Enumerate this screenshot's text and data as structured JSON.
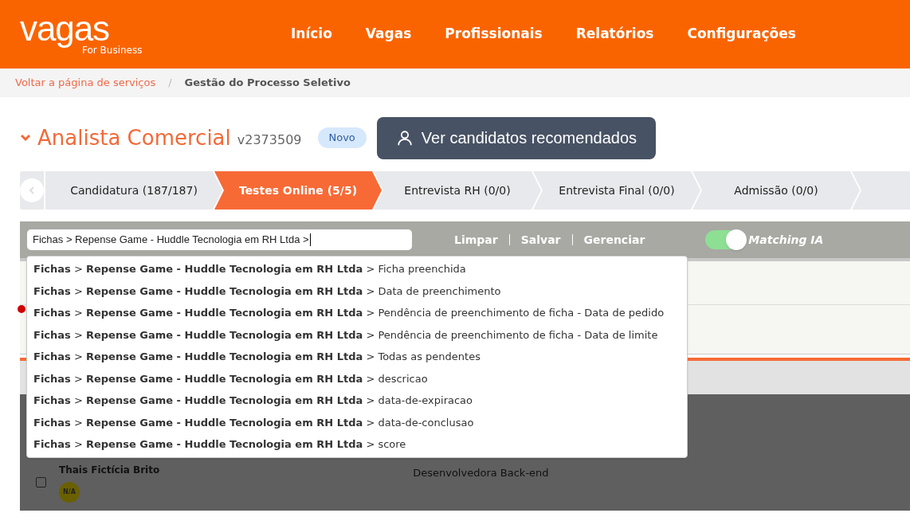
{
  "header": {
    "logo": "vagas",
    "logo_sub": "For Business",
    "nav": [
      {
        "label": "Início"
      },
      {
        "label": "Vagas"
      },
      {
        "label": "Profissionais"
      },
      {
        "label": "Relatórios"
      },
      {
        "label": "Configurações"
      }
    ]
  },
  "breadcrumb": {
    "link": "Voltar a página de serviços",
    "separator": "/",
    "current": "Gestão do Processo Seletivo"
  },
  "job": {
    "expanded": true,
    "title": "Analista Comercial",
    "code": "v2373509",
    "badge": "Novo",
    "recommend_button": "Ver candidatos recomendados"
  },
  "stages": [
    {
      "label": "Candidatura (187/187)",
      "selected": false
    },
    {
      "label": "Testes Online (5/5)",
      "selected": true
    },
    {
      "label": "Entrevista RH (0/0)",
      "selected": false
    },
    {
      "label": "Entrevista Final (0/0)",
      "selected": false
    },
    {
      "label": "Admissão (0/0)",
      "selected": false
    }
  ],
  "filter": {
    "value": "Fichas > Repense Game - Huddle Tecnologia em RH Ltda >",
    "actions": [
      "Limpar",
      "Salvar",
      "Gerenciar"
    ],
    "matching": {
      "label": "Matching IA",
      "on": true
    }
  },
  "suggestions": [
    "**Fichas** > **Repense Game - Huddle Tecnologia em RH Ltda** > Ficha preenchida",
    "**Fichas** > **Repense Game - Huddle Tecnologia em RH Ltda** > Data de preenchimento",
    "**Fichas** > **Repense Game - Huddle Tecnologia em RH Ltda** > Pendência de preenchimento de ficha - Data de pedido",
    "**Fichas** > **Repense Game - Huddle Tecnologia em RH Ltda** > Pendência de preenchimento de ficha - Data de limite",
    "**Fichas** > **Repense Game - Huddle Tecnologia em RH Ltda** > Todas as pendentes",
    "**Fichas** > **Repense Game - Huddle Tecnologia em RH Ltda** > descricao",
    "**Fichas** > **Repense Game - Huddle Tecnologia em RH Ltda** > data-de-expiracao",
    "**Fichas** > **Repense Game - Huddle Tecnologia em RH Ltda** > data-de-conclusao",
    "**Fichas** > **Repense Game - Huddle Tecnologia em RH Ltda** > score"
  ],
  "candidates": [
    {
      "name": "Thais Fictícia Brito",
      "badge": "N/A",
      "role": "Desenvolvedora Back-end",
      "checked": false
    }
  ]
}
